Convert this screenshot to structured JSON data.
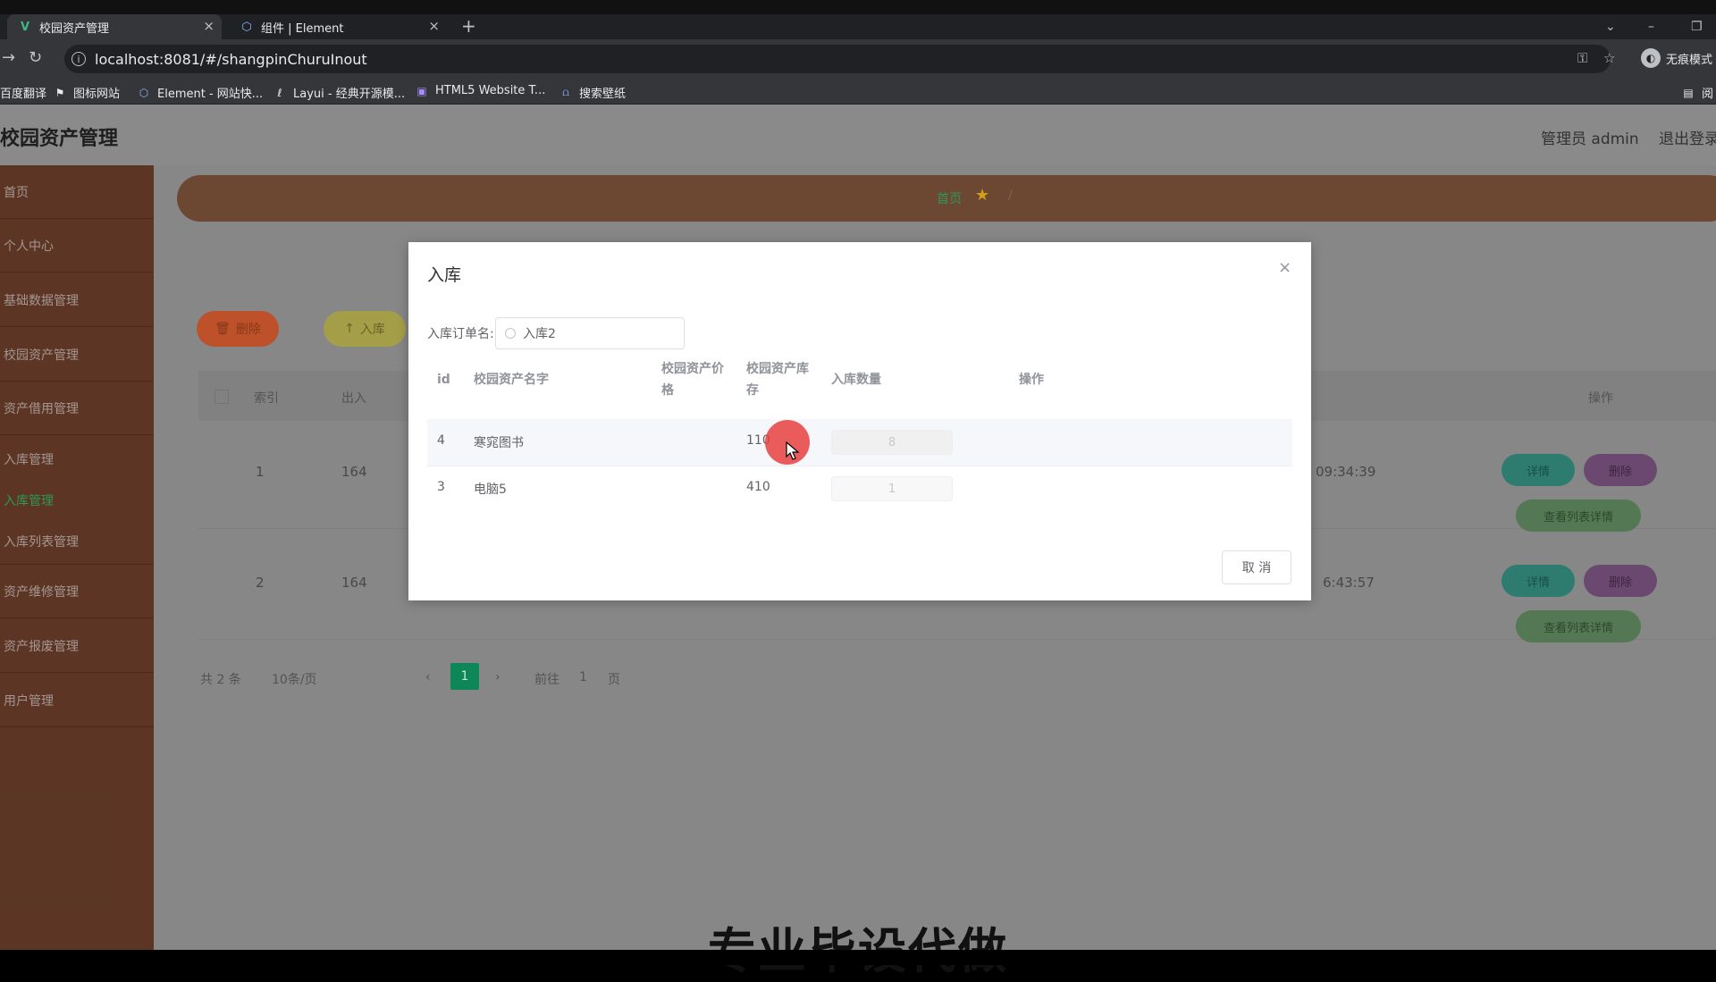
{
  "browser": {
    "tabs": [
      {
        "title": "校园资产管理",
        "favicon": "V",
        "close": "×"
      },
      {
        "title": "组件 | Element",
        "favicon": "⬡",
        "close": "×"
      }
    ],
    "new_tab": "+",
    "url": "localhost:8081/#/shangpinChuruInout",
    "profile": {
      "label": "无痕模式"
    },
    "bookmarks": [
      "百度翻译",
      "图标网站",
      "Element - 网站快...",
      "Layui - 经典开源模...",
      "HTML5 Website T...",
      "搜索壁纸"
    ],
    "bookmarks_right": "阅"
  },
  "app": {
    "title": "校园资产管理",
    "user": "管理员 admin",
    "logout": "退出登录"
  },
  "sidebar": {
    "items": [
      {
        "label": "首页"
      },
      {
        "label": "个人中心"
      },
      {
        "label": "基础数据管理"
      },
      {
        "label": "校园资产管理"
      },
      {
        "label": "资产借用管理"
      },
      {
        "label": "入库管理"
      },
      {
        "label": "入库管理"
      },
      {
        "label": "入库列表管理"
      },
      {
        "label": "资产维修管理"
      },
      {
        "label": "资产报废管理"
      },
      {
        "label": "用户管理"
      }
    ],
    "active_index": 6
  },
  "breadcrumb": {
    "home": "首页",
    "separator": "/"
  },
  "toolbar": {
    "delete_label": "删除",
    "inbound_label": "入库"
  },
  "table": {
    "headers": {
      "index": "索引",
      "col2": "出入",
      "action": "操作"
    },
    "rows": [
      {
        "index": "1",
        "col2": "164",
        "time": "09:34:39"
      },
      {
        "index": "2",
        "col2": "164",
        "time": "6:43:57"
      }
    ],
    "actions": {
      "detail": "详情",
      "delete": "删除",
      "list_detail": "查看列表详情"
    }
  },
  "pagination": {
    "total": "共 2 条",
    "page_size": "10条/页",
    "current": "1",
    "goto_label": "前往",
    "goto_value": "1",
    "page_unit": "页"
  },
  "dialog": {
    "title": "入库",
    "close": "×",
    "order_label": "入库订单名:",
    "order_value": "入库2",
    "headers": {
      "id": "id",
      "name": "校园资产名字",
      "price_l1": "校园资产价",
      "price_l2": "格",
      "stock_l1": "校园资产库",
      "stock_l2": "存",
      "qty": "入库数量",
      "op": "操作"
    },
    "rows": [
      {
        "id": "4",
        "name": "寒窕图书",
        "price": "",
        "stock": "110",
        "qty": "8"
      },
      {
        "id": "3",
        "name": "电脑5",
        "price": "",
        "stock": "410",
        "qty": "1"
      }
    ],
    "cancel_label": "取 消"
  },
  "subtitle": "专业毕设代做",
  "colors": {
    "sidebar": "#5e3726",
    "accent_green": "#0f8a5a",
    "header": "#8d8d8d"
  }
}
